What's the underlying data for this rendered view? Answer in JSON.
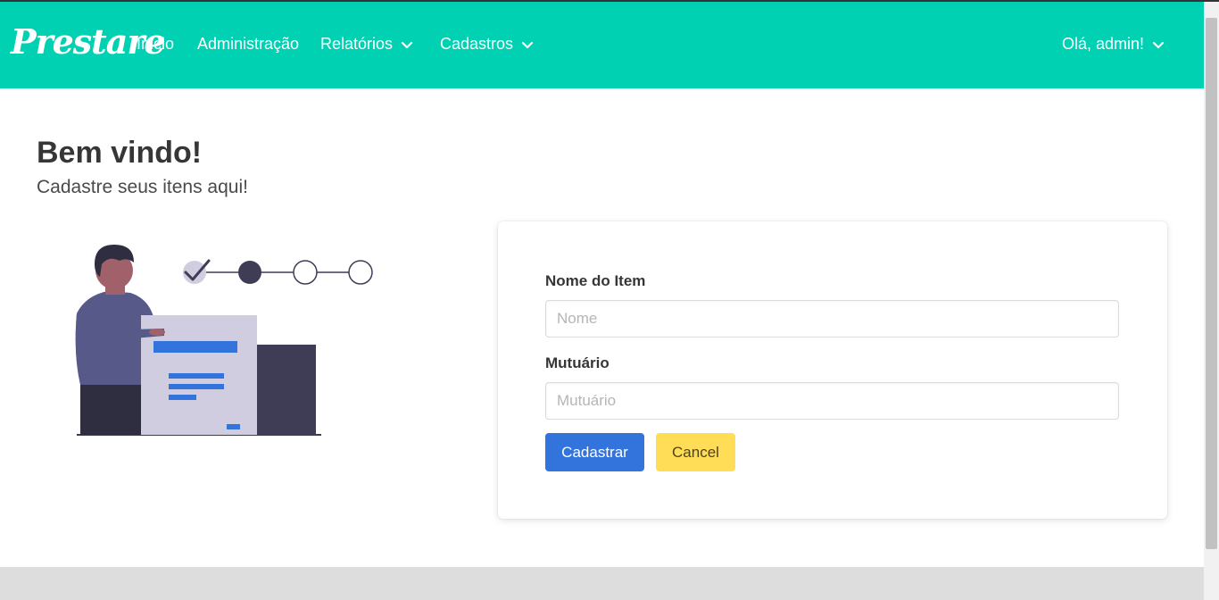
{
  "navbar": {
    "brand": "Prestare",
    "items": [
      {
        "label": "Inicio"
      },
      {
        "label": "Administração"
      },
      {
        "label": "Relatórios"
      },
      {
        "label": "Cadastros"
      }
    ],
    "user_label": "Olá, admin!"
  },
  "hero": {
    "title": "Bem vindo!",
    "subtitle": "Cadastre seus itens aqui!"
  },
  "form": {
    "name_label": "Nome do Item",
    "name_placeholder": "Nome",
    "name_value": "",
    "borrower_label": "Mutuário",
    "borrower_placeholder": "Mutuário",
    "borrower_value": "",
    "submit_label": "Cadastrar",
    "cancel_label": "Cancel"
  },
  "colors": {
    "navbar": "#00d1b2",
    "primary": "#3273dc",
    "warning": "#ffdd57"
  },
  "icons": {
    "dropdown": "chevron-down-icon"
  }
}
